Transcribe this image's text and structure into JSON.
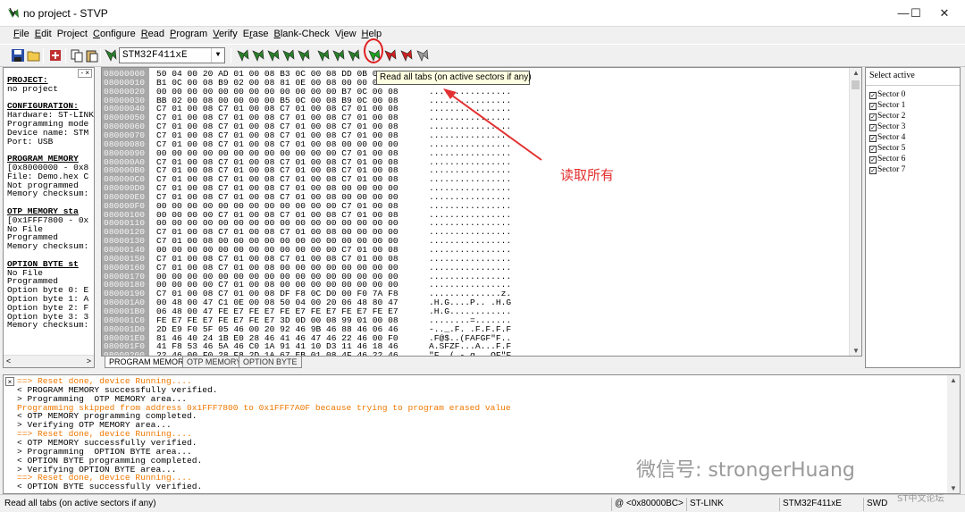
{
  "window": {
    "title": "no project - STVP",
    "minimize": "—",
    "maximize": "☐",
    "close": "✕"
  },
  "menu": [
    {
      "pre": "",
      "u": "F",
      "post": "ile"
    },
    {
      "pre": "",
      "u": "E",
      "post": "dit"
    },
    {
      "pre": "Pro",
      "u": "j",
      "post": "ect"
    },
    {
      "pre": "",
      "u": "C",
      "post": "onfigure"
    },
    {
      "pre": "",
      "u": "R",
      "post": "ead"
    },
    {
      "pre": "",
      "u": "P",
      "post": "rogram"
    },
    {
      "pre": "",
      "u": "V",
      "post": "erify"
    },
    {
      "pre": "E",
      "u": "r",
      "post": "ase"
    },
    {
      "pre": "",
      "u": "B",
      "post": "lank-Check"
    },
    {
      "pre": "V",
      "u": "i",
      "post": "ew"
    },
    {
      "pre": "",
      "u": "H",
      "post": "elp"
    }
  ],
  "toolbar": {
    "device": "STM32F411xE",
    "tooltip": "Read all tabs (on active sectors if any)"
  },
  "left_panel": {
    "lines": [
      {
        "t": "PROJECT:",
        "h": true
      },
      {
        "t": "no project"
      },
      {
        "t": ""
      },
      {
        "t": "CONFIGURATION:",
        "h": true
      },
      {
        "t": "Hardware: ST-LINK"
      },
      {
        "t": "Programming mode"
      },
      {
        "t": "Device name: STM"
      },
      {
        "t": "Port: USB"
      },
      {
        "t": ""
      },
      {
        "t": "PROGRAM MEMORY",
        "h": true
      },
      {
        "t": "[0x8000000 - 0x8"
      },
      {
        "t": "File: Demo.hex C"
      },
      {
        "t": "Not programmed"
      },
      {
        "t": "Memory checksum:"
      },
      {
        "t": ""
      },
      {
        "t": "OTP MEMORY sta",
        "h": true
      },
      {
        "t": "[0x1FFF7800 - 0x"
      },
      {
        "t": "No File"
      },
      {
        "t": "Programmed"
      },
      {
        "t": "Memory checksum:"
      },
      {
        "t": ""
      },
      {
        "t": "OPTION BYTE st",
        "h": true
      },
      {
        "t": "No File"
      },
      {
        "t": "Programmed"
      },
      {
        "t": "Option byte 0: E"
      },
      {
        "t": "Option byte 1: A"
      },
      {
        "t": "Option byte 2: F"
      },
      {
        "t": "Option byte 3: 3"
      },
      {
        "t": "Memory checksum:"
      }
    ]
  },
  "hex_rows": [
    {
      "a": "08000000",
      "b": "50 04 00 20 AD 01 00 08 B3 0C 00 08 DD 0B 00 08",
      "s": "P..."
    },
    {
      "a": "08000010",
      "b": "B1 0C 00 08 B9 02 00 08 81 0E 00 08 00 00 00 00",
      "s": ""
    },
    {
      "a": "08000020",
      "b": "00 00 00 00 00 00 00 00 00 00 00 00 B7 0C 00 08",
      "s": "................"
    },
    {
      "a": "08000030",
      "b": "BB 02 00 08 00 00 00 00 B5 0C 00 08 B9 0C 00 08",
      "s": "................"
    },
    {
      "a": "08000040",
      "b": "C7 01 00 08 C7 01 00 08 C7 01 00 08 C7 01 00 08",
      "s": "................"
    },
    {
      "a": "08000050",
      "b": "C7 01 00 08 C7 01 00 08 C7 01 00 08 C7 01 00 08",
      "s": "................"
    },
    {
      "a": "08000060",
      "b": "C7 01 00 08 C7 01 00 08 C7 01 00 08 C7 01 00 08",
      "s": "................"
    },
    {
      "a": "08000070",
      "b": "C7 01 00 08 C7 01 00 08 C7 01 00 08 C7 01 00 08",
      "s": "................"
    },
    {
      "a": "08000080",
      "b": "C7 01 00 08 C7 01 00 08 C7 01 00 08 00 00 00 00",
      "s": "................"
    },
    {
      "a": "08000090",
      "b": "00 00 00 00 00 00 00 00 00 00 00 00 C7 01 00 08",
      "s": "................"
    },
    {
      "a": "080000A0",
      "b": "C7 01 00 08 C7 01 00 08 C7 01 00 08 C7 01 00 08",
      "s": "................"
    },
    {
      "a": "080000B0",
      "b": "C7 01 00 08 C7 01 00 08 C7 01 00 08 C7 01 00 08",
      "s": "................"
    },
    {
      "a": "080000C0",
      "b": "C7 01 00 08 C7 01 00 08 C7 01 00 08 C7 01 00 08",
      "s": "................"
    },
    {
      "a": "080000D0",
      "b": "C7 01 00 08 C7 01 00 08 C7 01 00 08 00 00 00 00",
      "s": "................"
    },
    {
      "a": "080000E0",
      "b": "C7 01 00 08 C7 01 00 08 C7 01 00 08 00 00 00 00",
      "s": "................"
    },
    {
      "a": "080000F0",
      "b": "00 00 00 00 00 00 00 00 00 00 00 00 C7 01 00 08",
      "s": "................"
    },
    {
      "a": "08000100",
      "b": "00 00 00 00 C7 01 00 08 C7 01 00 08 C7 01 00 08",
      "s": "................"
    },
    {
      "a": "08000110",
      "b": "00 00 00 00 00 00 00 00 00 00 00 00 00 00 00 00",
      "s": "................"
    },
    {
      "a": "08000120",
      "b": "C7 01 00 08 C7 01 00 08 C7 01 00 08 00 00 00 00",
      "s": "................"
    },
    {
      "a": "08000130",
      "b": "C7 01 00 08 00 00 00 00 00 00 00 00 00 00 00 00",
      "s": "................"
    },
    {
      "a": "08000140",
      "b": "00 00 00 00 00 00 00 00 00 00 00 00 C7 01 00 08",
      "s": "................"
    },
    {
      "a": "08000150",
      "b": "C7 01 00 08 C7 01 00 08 C7 01 00 08 C7 01 00 08",
      "s": "................"
    },
    {
      "a": "08000160",
      "b": "C7 01 00 08 C7 01 00 08 00 00 00 00 00 00 00 00",
      "s": "................"
    },
    {
      "a": "08000170",
      "b": "00 00 00 00 00 00 00 00 00 00 00 00 00 00 00 00",
      "s": "................"
    },
    {
      "a": "08000180",
      "b": "00 00 00 00 C7 01 00 08 00 00 00 00 00 00 00 00",
      "s": "................"
    },
    {
      "a": "08000190",
      "b": "C7 01 00 08 C7 01 00 08 DF F8 0C D0 00 F0 7A F8",
      "s": "..............z."
    },
    {
      "a": "080001A0",
      "b": "00 48 00 47 C1 0E 00 08 50 04 00 20 06 48 80 47",
      "s": ".H.G....P.. .H.G"
    },
    {
      "a": "080001B0",
      "b": "06 48 00 47 FE E7 FE E7 FE E7 FE E7 FE E7 FE E7",
      "s": ".H.G............"
    },
    {
      "a": "080001C0",
      "b": "FE E7 FE E7 FE E7 FE E7 3D 0D 00 08 99 01 00 08",
      "s": "........=......."
    },
    {
      "a": "080001D0",
      "b": "2D E9 F0 5F 05 46 00 20 92 46 9B 46 88 46 06 46",
      "s": "-.._.F. .F.F.F.F"
    },
    {
      "a": "080001E0",
      "b": "81 46 40 24 1B E0 28 46 41 46 47 46 22 46 00 F0",
      "s": ".F@$..(FAFGF\"F.."
    },
    {
      "a": "080001F0",
      "b": "41 F8 53 46 5A 46 C0 1A 91 41 10 D3 11 46 18 46",
      "s": "A.SFZF...A...F.F"
    },
    {
      "a": "08000200",
      "b": "22 46 00 F0 28 F8 2D 1A 67 EB 01 08 4F 46 22 46",
      "s": "\"F..(.-.g...OF\"F"
    }
  ],
  "mem_tabs": [
    "PROGRAM MEMORY",
    "OTP MEMORY",
    "OPTION BYTE"
  ],
  "sectors": {
    "header": "Select active",
    "items": [
      "Sector 0",
      "Sector 1",
      "Sector 2",
      "Sector 3",
      "Sector 4",
      "Sector 5",
      "Sector 6",
      "Sector 7"
    ]
  },
  "log": [
    {
      "t": "==> Reset done, device Running....",
      "c": "orange"
    },
    {
      "t": "< PROGRAM MEMORY successfully verified.",
      "c": ""
    },
    {
      "t": "> Programming  OTP MEMORY area...",
      "c": ""
    },
    {
      "t": "Programming skipped from address 0x1FFF7800 to 0x1FFF7A0F because trying to program erased value",
      "c": "orange"
    },
    {
      "t": "< OTP MEMORY programming completed.",
      "c": ""
    },
    {
      "t": "> Verifying OTP MEMORY area...",
      "c": ""
    },
    {
      "t": "==> Reset done, device Running....",
      "c": "orange"
    },
    {
      "t": "< OTP MEMORY successfully verified.",
      "c": ""
    },
    {
      "t": "> Programming  OPTION BYTE area...",
      "c": ""
    },
    {
      "t": "< OPTION BYTE programming completed.",
      "c": ""
    },
    {
      "t": "> Verifying OPTION BYTE area...",
      "c": ""
    },
    {
      "t": "==> Reset done, device Running....",
      "c": "orange"
    },
    {
      "t": "< OPTION BYTE successfully verified.",
      "c": ""
    }
  ],
  "status": {
    "message": "Read all tabs (on active sectors if any)",
    "address": "@ <0x80000BC>",
    "hardware": "ST-LINK",
    "device": "STM32F411xE",
    "protocol": "SWD"
  },
  "annotation": {
    "label": "读取所有",
    "watermark": "微信号: strongerHuang",
    "watermark2": "ST中文论坛"
  },
  "colors": {
    "accent_red": "#e02020",
    "log_orange": "#f07800",
    "address_gray": "#a8a8a8"
  }
}
